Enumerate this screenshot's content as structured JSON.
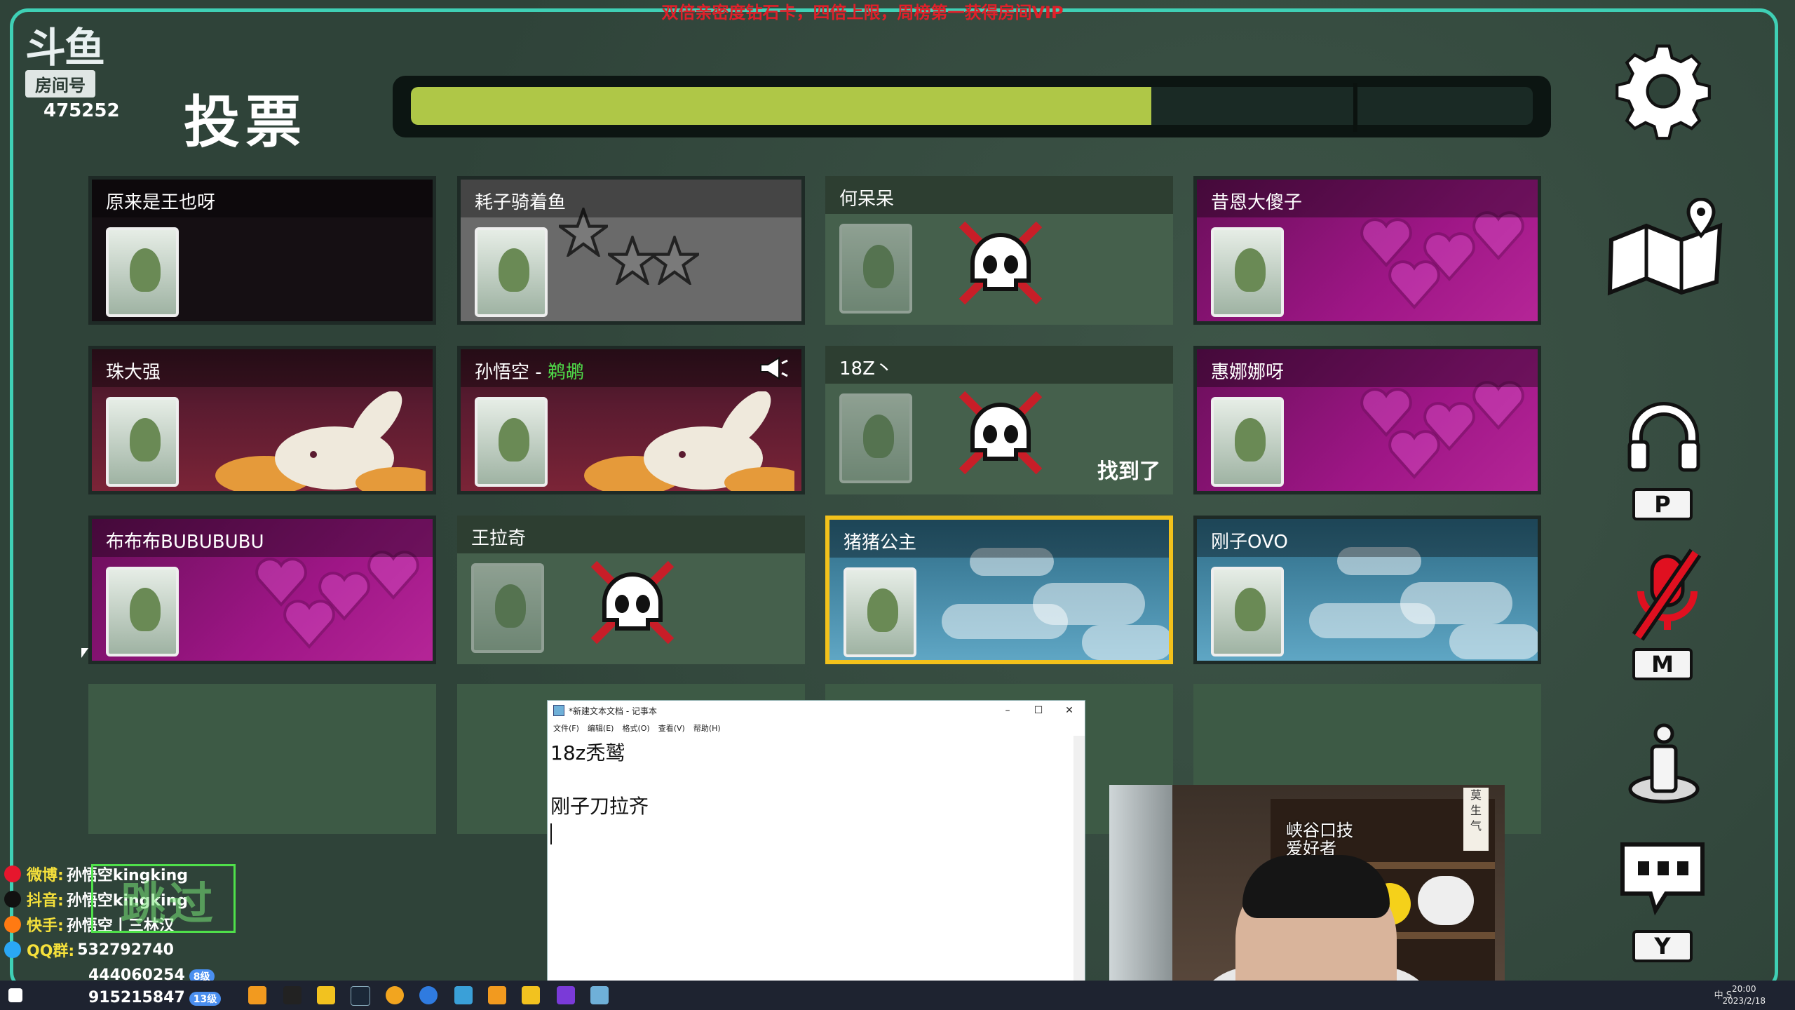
{
  "banner": "双倍亲密度钻石卡，四倍上限，周榜第一获得房间VIP",
  "logo": {
    "brand": "斗鱼",
    "room_label": "房间号",
    "room_number": "475252"
  },
  "title": "投票",
  "timer": {
    "progress": 0.66
  },
  "players": [
    {
      "name": "原来是王也呀",
      "role": "",
      "status": "alive",
      "bg": "dark"
    },
    {
      "name": "耗子骑着鱼",
      "role": "",
      "status": "alive",
      "bg": "gray"
    },
    {
      "name": "何呆呆",
      "role": "",
      "status": "dead",
      "bg": "dead"
    },
    {
      "name": "昔恩大傻子",
      "role": "",
      "status": "alive",
      "bg": "pink"
    },
    {
      "name": "珠大强",
      "role": "",
      "status": "alive",
      "bg": "rabbit"
    },
    {
      "name": "孙悟空 - ",
      "role": "鹈鹕",
      "status": "alive",
      "bg": "rabbit",
      "speaking": true
    },
    {
      "name": "18Z丶",
      "role": "",
      "status": "dead",
      "bg": "dead",
      "found": "找到了"
    },
    {
      "name": "惠娜娜呀",
      "role": "",
      "status": "alive",
      "bg": "pink"
    },
    {
      "name": "布布布BUBUBUBU",
      "role": "",
      "status": "alive",
      "bg": "pink"
    },
    {
      "name": "王拉奇",
      "role": "",
      "status": "dead",
      "bg": "dead"
    },
    {
      "name": "猪猪公主",
      "role": "",
      "status": "alive",
      "bg": "sky",
      "highlight": true
    },
    {
      "name": "刚子OVO",
      "role": "",
      "status": "alive",
      "bg": "sky"
    }
  ],
  "side_controls": [
    {
      "name": "settings-gear-icon"
    },
    {
      "name": "map-icon"
    },
    {
      "name": "headphones-icon",
      "key": "P"
    },
    {
      "name": "mic-muted-icon",
      "key": "M"
    },
    {
      "name": "info-icon"
    },
    {
      "name": "chat-icon",
      "key": "Y"
    }
  ],
  "notepad": {
    "title": "*新建文本文档 - 记事本",
    "menu": [
      "文件(F)",
      "编辑(E)",
      "格式(O)",
      "查看(V)",
      "帮助(H)"
    ],
    "lines": [
      "18z秃鹫",
      "",
      "刚子刀拉齐"
    ]
  },
  "webcam": {
    "sign": "峡谷口技\n爱好者",
    "scroll": "莫\n生\n气"
  },
  "socials": [
    {
      "label": "微博:",
      "value": "孙悟空kingking",
      "color": "#e6162d"
    },
    {
      "label": "抖音:",
      "value": "孙悟空kingking",
      "color": "#111111"
    },
    {
      "label": "快手:",
      "value": "孙悟空丨三林汉",
      "color": "#ff7a12"
    },
    {
      "label": "QQ群:",
      "value": "532792740",
      "color": "#2aa7f5"
    }
  ],
  "skip": "跳过",
  "fan_groups": [
    {
      "value": "444060254",
      "badge": "8级"
    },
    {
      "value": "915215847",
      "badge": "13级"
    }
  ],
  "taskbar": {
    "tray": "中  S",
    "time": "20:00",
    "date": "2023/2/18"
  }
}
